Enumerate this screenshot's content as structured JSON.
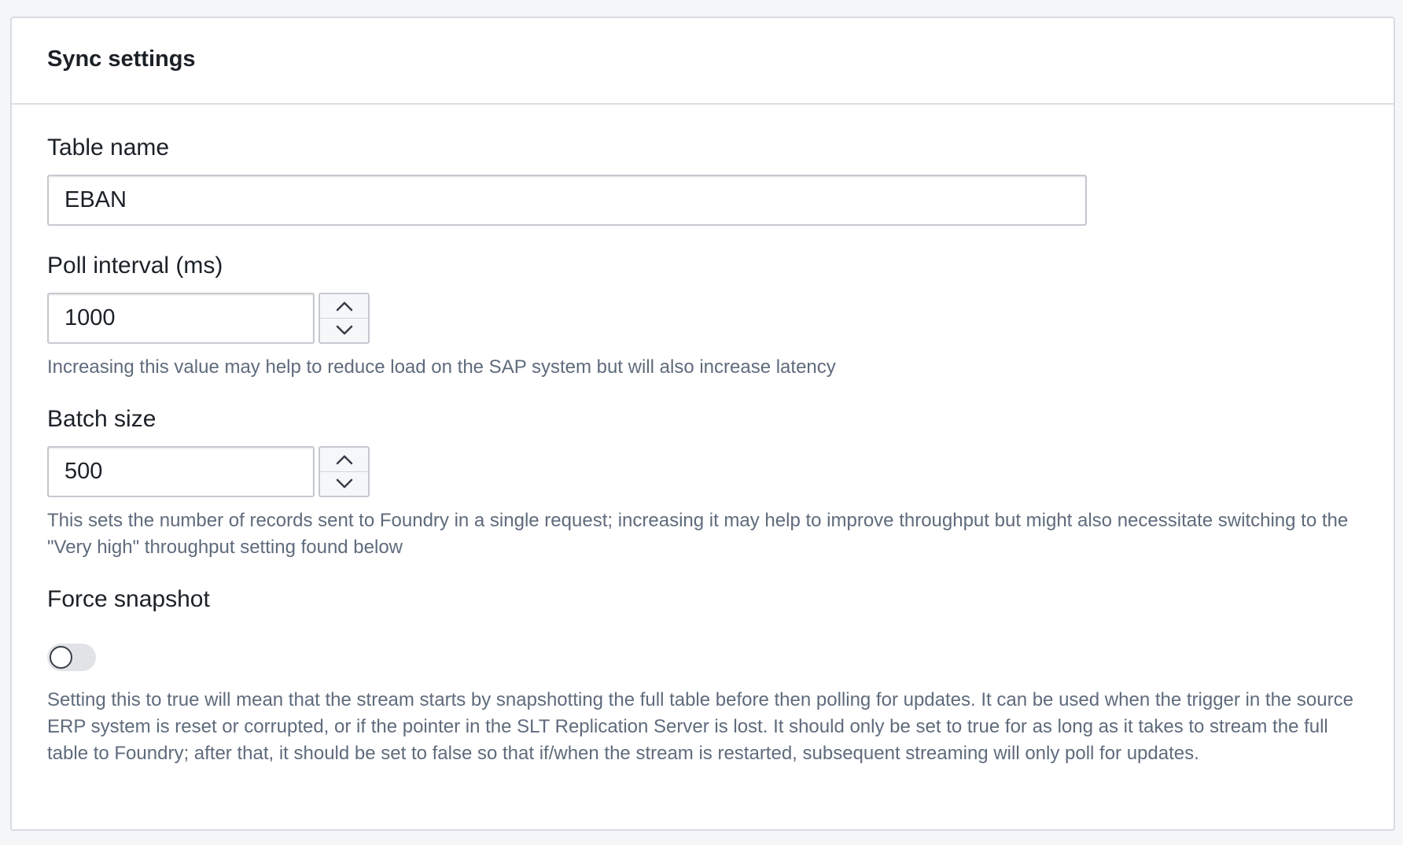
{
  "panel": {
    "title": "Sync settings"
  },
  "fields": {
    "table_name": {
      "label": "Table name",
      "value": "EBAN"
    },
    "poll_interval": {
      "label": "Poll interval (ms)",
      "value": "1000",
      "helper": "Increasing this value may help to reduce load on the SAP system but will also increase latency"
    },
    "batch_size": {
      "label": "Batch size",
      "value": "500",
      "helper": "This sets the number of records sent to Foundry in a single request; increasing it may help to improve throughput but might also necessitate switching to the \"Very high\" throughput setting found below"
    },
    "force_snapshot": {
      "label": "Force snapshot",
      "enabled": false,
      "helper": "Setting this to true will mean that the stream starts by snapshotting the full table before then polling for updates. It can be used when the trigger in the source ERP system is reset or corrupted, or if the pointer in the SLT Replication Server is lost. It should only be set to true for as long as it takes to stream the full table to Foundry; after that, it should be set to false so that if/when the stream is restarted, subsequent streaming will only poll for updates."
    }
  },
  "icons": {
    "increment": "chevron-up-icon",
    "decrement": "chevron-down-icon"
  },
  "colors": {
    "helper_text": "#5f6b7c",
    "border": "#c5c9cf",
    "toggle_off": "#e1e3e7"
  }
}
